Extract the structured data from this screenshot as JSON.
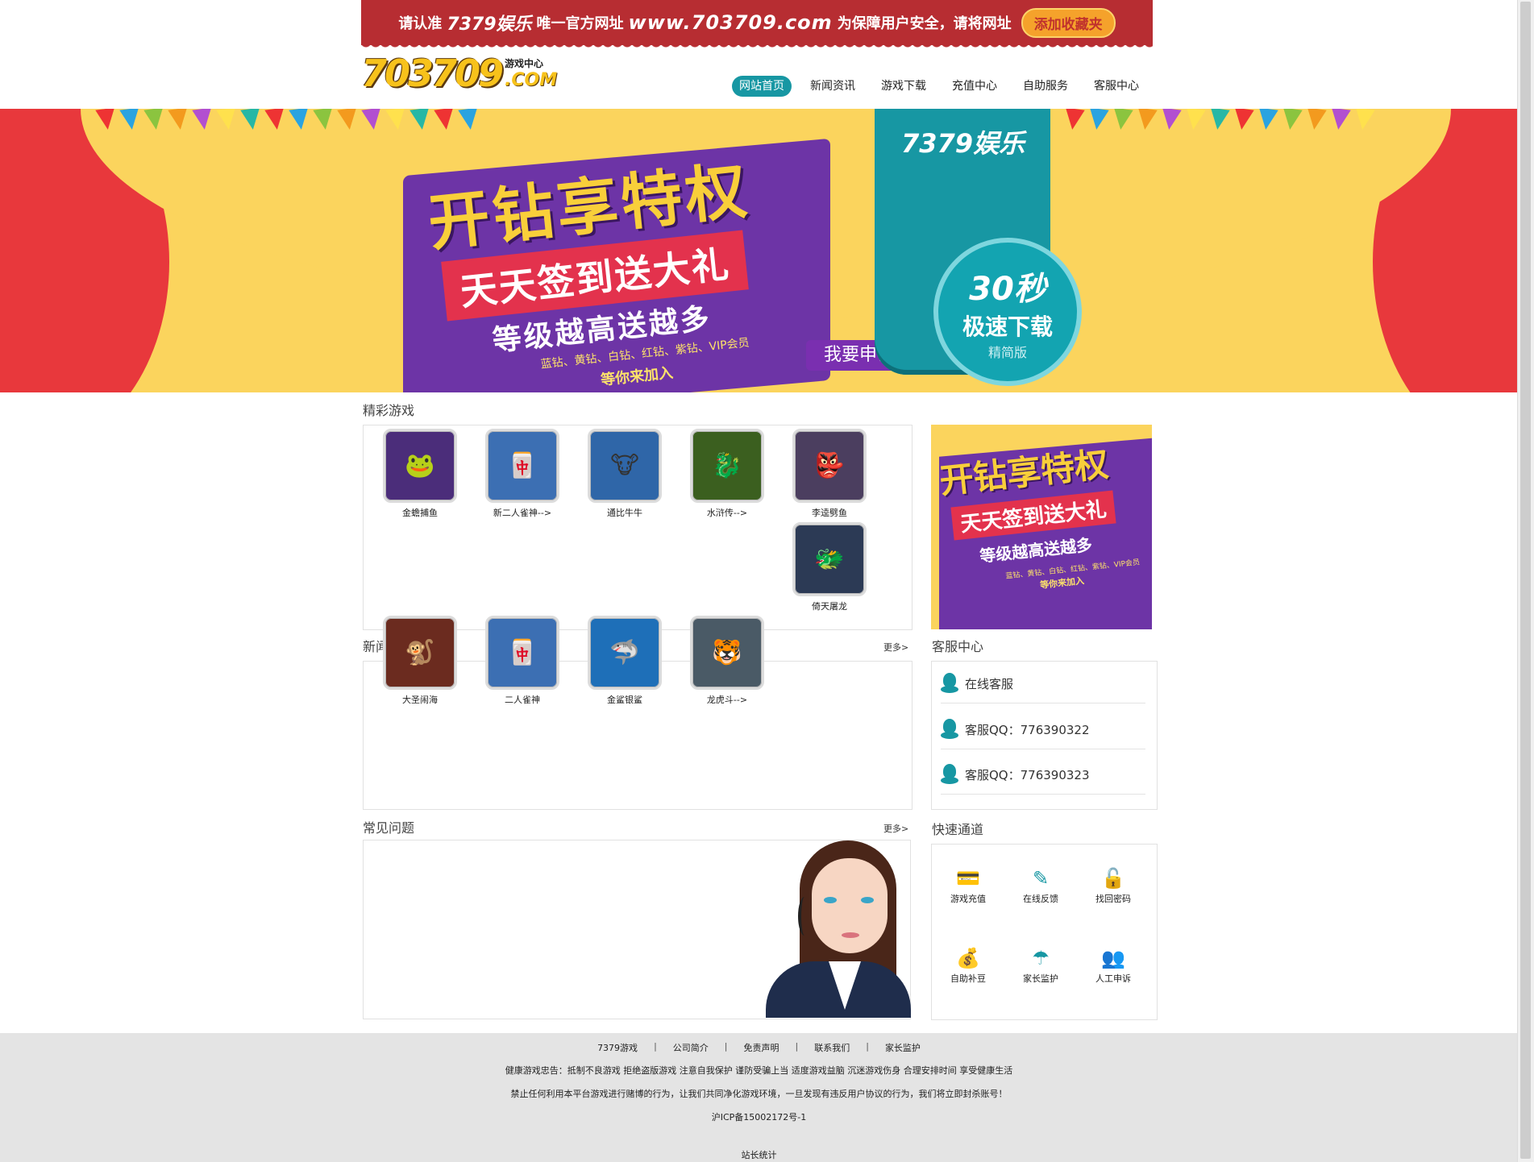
{
  "topbar": {
    "prefix": "请认准",
    "brand": "7379娱乐",
    "middle": "唯一官方网址",
    "site": "www.703709.com",
    "suffix": "为保障用户安全，请将网址",
    "fav_button": "添加收藏夹"
  },
  "logo": {
    "number": "703709",
    "sub": "游戏中心",
    "com": ".COM"
  },
  "nav": [
    "网站首页",
    "新闻资讯",
    "游戏下载",
    "充值中心",
    "自助服务",
    "客服中心"
  ],
  "banner": {
    "title": "开钻享特权",
    "ribbon": "天天签到送大礼",
    "line3": "等级越高送越多",
    "line4": "蓝钻、黄钻、白钻、红钻、紫钻、VIP会员",
    "line5": "等你来加入",
    "apply_button": "我要申请",
    "download_brand": "7379娱乐",
    "download_seconds": "30秒",
    "download_fast": "极速下载",
    "download_lite": "精简版"
  },
  "sections": {
    "games_title": "精彩游戏",
    "news_title": "新闻",
    "faq_title": "常见问题",
    "more": "更多>",
    "cs_title": "客服中心",
    "quick_title": "快速通道"
  },
  "games": [
    {
      "name": "金蟾捕鱼",
      "icon": "golden-toad-icon",
      "glyph": "🐸",
      "color": "#4b2d7a"
    },
    {
      "name": "新二人雀神-->",
      "icon": "mahjong-kids-icon",
      "glyph": "🀄",
      "color": "#3c6fb3"
    },
    {
      "name": "通比牛牛",
      "icon": "cartoon-ox-icon",
      "glyph": "🐮",
      "color": "#2f66a8"
    },
    {
      "name": "水浒传-->",
      "icon": "dragon-icon",
      "glyph": "🐉",
      "color": "#3b5f1f"
    },
    {
      "name": "李逵劈鱼",
      "icon": "warrior-icon",
      "glyph": "👺",
      "color": "#4b3e5f"
    },
    {
      "name": "倚天屠龙",
      "icon": "dragon-knight-icon",
      "glyph": "🐲",
      "color": "#2c3a55"
    },
    {
      "name": "大圣闹海",
      "icon": "monkey-king-icon",
      "glyph": "🐒",
      "color": "#6b2b1f"
    },
    {
      "name": "二人雀神",
      "icon": "mahjong-kids-icon",
      "glyph": "🀄",
      "color": "#3c6fb3"
    },
    {
      "name": "金鲨银鲨",
      "icon": "shark-icon",
      "glyph": "🦈",
      "color": "#1e6fb8"
    },
    {
      "name": "龙虎斗-->",
      "icon": "dragon-tiger-icon",
      "glyph": "🐯",
      "color": "#4a5a66"
    }
  ],
  "customer_service": [
    {
      "label": "在线客服"
    },
    {
      "label": "客服QQ：776390322"
    },
    {
      "label": "客服QQ：776390323"
    }
  ],
  "quick_links": [
    {
      "label": "游戏充值",
      "icon": "credit-card-icon",
      "glyph": "💳"
    },
    {
      "label": "在线反馈",
      "icon": "edit-icon",
      "glyph": "✎"
    },
    {
      "label": "找回密码",
      "icon": "lock-icon",
      "glyph": "🔓"
    },
    {
      "label": "自助补豆",
      "icon": "wallet-icon",
      "glyph": "💰"
    },
    {
      "label": "家长监护",
      "icon": "umbrella-icon",
      "glyph": "☂"
    },
    {
      "label": "人工申诉",
      "icon": "support-agent-icon",
      "glyph": "👥"
    }
  ],
  "footer": {
    "links": [
      "7379游戏",
      "公司简介",
      "免责声明",
      "联系我们",
      "家长监护"
    ],
    "separator": "|",
    "advice": "健康游戏忠告：抵制不良游戏  拒绝盗版游戏  注意自我保护  谨防受骗上当  适度游戏益脑  沉迷游戏伤身  合理安排时间  享受健康生活",
    "warning": "禁止任何利用本平台游戏进行赌博的行为，让我们共同净化游戏环境，一旦发现有违反用户协议的行为，我们将立即封杀账号！",
    "icp": "沪ICP备15002172号-1",
    "stats": "站长统计"
  },
  "colors": {
    "brand_red": "#b72d32",
    "teal": "#1797a3",
    "banner_yellow": "#fbd45d",
    "promo_purple": "#6d34a6",
    "footer_gray": "#e4e4e4"
  }
}
